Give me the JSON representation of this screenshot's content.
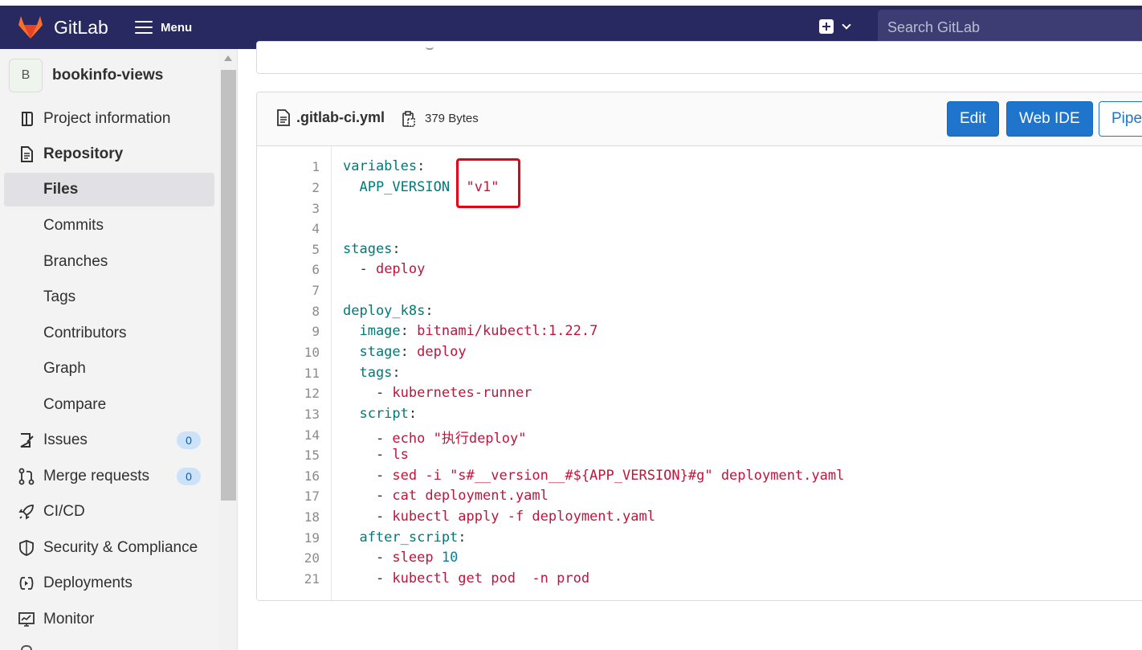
{
  "navbar": {
    "brand": "GitLab",
    "menu_label": "Menu",
    "search_placeholder": "Search GitLab",
    "colors": {
      "background": "#292961",
      "logo_orange": "#fc6d26"
    }
  },
  "sidebar": {
    "project_avatar": "B",
    "project_name": "bookinfo-views",
    "items": [
      {
        "label": "Project information",
        "icon": "project-info-icon"
      },
      {
        "label": "Repository",
        "icon": "repository-icon"
      },
      {
        "label": "Files"
      },
      {
        "label": "Commits"
      },
      {
        "label": "Branches"
      },
      {
        "label": "Tags"
      },
      {
        "label": "Contributors"
      },
      {
        "label": "Graph"
      },
      {
        "label": "Compare"
      },
      {
        "label": "Issues",
        "icon": "issues-icon",
        "badge": "0"
      },
      {
        "label": "Merge requests",
        "icon": "merge-request-icon",
        "badge": "0"
      },
      {
        "label": "CI/CD",
        "icon": "rocket-icon"
      },
      {
        "label": "Security & Compliance",
        "icon": "shield-icon"
      },
      {
        "label": "Deployments",
        "icon": "deployments-icon"
      },
      {
        "label": "Monitor",
        "icon": "monitor-icon"
      }
    ]
  },
  "file": {
    "name": ".gitlab-ci.yml",
    "size": "379 Bytes",
    "buttons": {
      "edit": "Edit",
      "web_ide": "Web IDE",
      "pipeline": "Pipel"
    }
  },
  "code": {
    "line_numbers": [
      "1",
      "2",
      "3",
      "4",
      "5",
      "6",
      "7",
      "8",
      "9",
      "10",
      "11",
      "12",
      "13",
      "14",
      "15",
      "16",
      "17",
      "18",
      "19",
      "20",
      "21"
    ],
    "l1_key": "variables",
    "l1_colon": ":",
    "l2_key": "  APP_VERSION",
    "l2_val": "\"v1\"",
    "l5_key": "stages",
    "l5_colon": ":",
    "l6_dash": "  - ",
    "l6_val": "deploy",
    "l8_key": "deploy_k8s",
    "l8_colon": ":",
    "l9_key": "  image",
    "l9_colon": ": ",
    "l9_val": "bitnami/kubectl:1.22.7",
    "l10_key": "  stage",
    "l10_colon": ": ",
    "l10_val": "deploy",
    "l11_key": "  tags",
    "l11_colon": ":",
    "l12_dash": "    - ",
    "l12_val": "kubernetes-runner",
    "l13_key": "  script",
    "l13_colon": ":",
    "l14_dash": "    - ",
    "l14_val": "echo \"执行deploy\"",
    "l15_dash": "    - ",
    "l15_val": "ls",
    "l16_dash": "    - ",
    "l16_val": "sed -i \"s#__version__#${APP_VERSION}#g\" deployment.yaml",
    "l17_dash": "    - ",
    "l17_val": "cat deployment.yaml",
    "l18_dash": "    - ",
    "l18_val": "kubectl apply -f deployment.yaml",
    "l19_key": "  after_script",
    "l19_colon": ":",
    "l20_dash": "    - ",
    "l20_val": "sleep ",
    "l20_num": "10",
    "l21_dash": "    - ",
    "l21_val": "kubectl get pod  -n prod"
  }
}
